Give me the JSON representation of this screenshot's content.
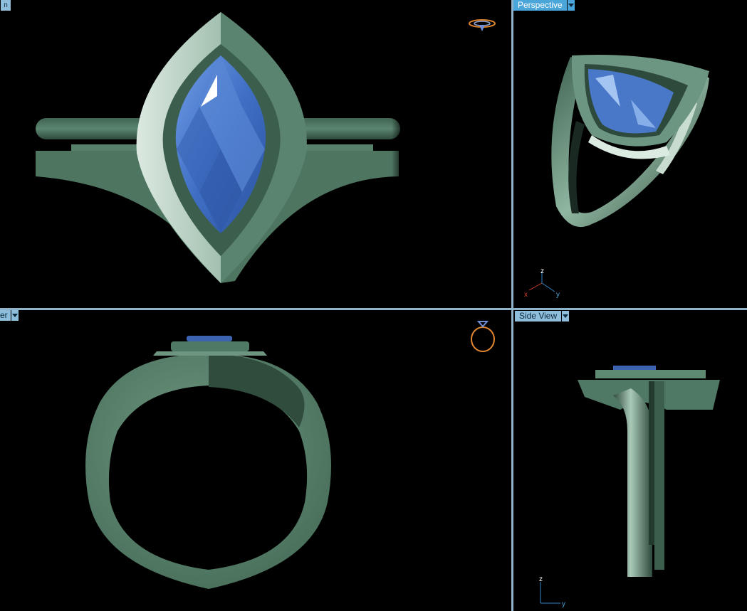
{
  "viewports": {
    "top": {
      "label": "n"
    },
    "perspective": {
      "label": "Perspective",
      "active": true
    },
    "front": {
      "label": "er"
    },
    "side": {
      "label": "Side View"
    }
  },
  "axes": {
    "perspective": {
      "x": "x",
      "y": "y",
      "z": "z"
    },
    "side": {
      "y": "y",
      "z": "z"
    }
  },
  "colors": {
    "background": "#000000",
    "metal": "#5f8a72",
    "metal_highlight": "#d6e6dc",
    "gem": "#4a78c8",
    "gem_highlight": "#9fc2f0",
    "separator": "#8fb3c9",
    "active_label": "#4aa6d9",
    "view_icon": "#e0862f"
  }
}
